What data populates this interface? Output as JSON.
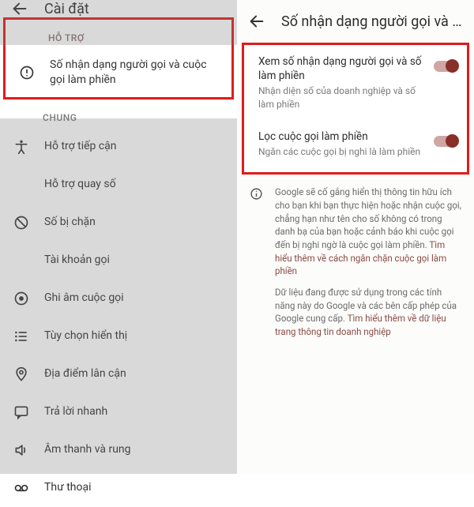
{
  "left": {
    "title": "Cài đặt",
    "support_section": "HỖ TRỢ",
    "support_item": "Số nhận dạng người gọi và cuộc gọi làm phiền",
    "general_section": "CHUNG",
    "items": [
      {
        "icon": "accessibility",
        "label": "Hỗ trợ tiếp cận"
      },
      {
        "icon": "none",
        "label": "Hỗ trợ quay số"
      },
      {
        "icon": "block",
        "label": "Số bị chặn"
      },
      {
        "icon": "none",
        "label": "Tài khoản gọi"
      },
      {
        "icon": "record",
        "label": "Ghi âm cuộc gọi"
      },
      {
        "icon": "list",
        "label": "Tùy chọn hiển thị"
      },
      {
        "icon": "pin",
        "label": "Địa điểm lân cận"
      },
      {
        "icon": "chat",
        "label": "Trả lời nhanh"
      },
      {
        "icon": "volume",
        "label": "Âm thanh và rung"
      },
      {
        "icon": "voicemail",
        "label": "Thư thoại"
      }
    ]
  },
  "right": {
    "title": "Số nhận dạng người gọi và cuộ...",
    "settings": [
      {
        "title": "Xem số nhận dạng người gọi và số làm phiền",
        "sub": "Nhận diện số của doanh nghiệp và số làm phiền",
        "on": true
      },
      {
        "title": "Lọc cuộc gọi làm phiền",
        "sub": "Ngăn các cuộc gọi bị nghi là làm phiền",
        "on": true
      }
    ],
    "info1a": "Google sẽ cố gắng hiển thị thông tin hữu ích cho bạn khi bạn thực hiện hoặc nhận cuộc gọi, chẳng hạn như tên cho số không có trong danh bạ của bạn hoặc cảnh báo khi cuộc gọi đến bị nghi ngờ là cuộc gọi làm phiền. ",
    "info1b": "Tìm hiểu thêm về cách ngăn chặn cuộc gọi làm phiền",
    "info2a": "Dữ liệu đang được sử dụng trong các tính năng này do Google và các bên cấp phép của Google cung cấp. ",
    "info2b": "Tìm hiểu thêm về dữ liệu trang thông tin doanh nghiệp"
  }
}
